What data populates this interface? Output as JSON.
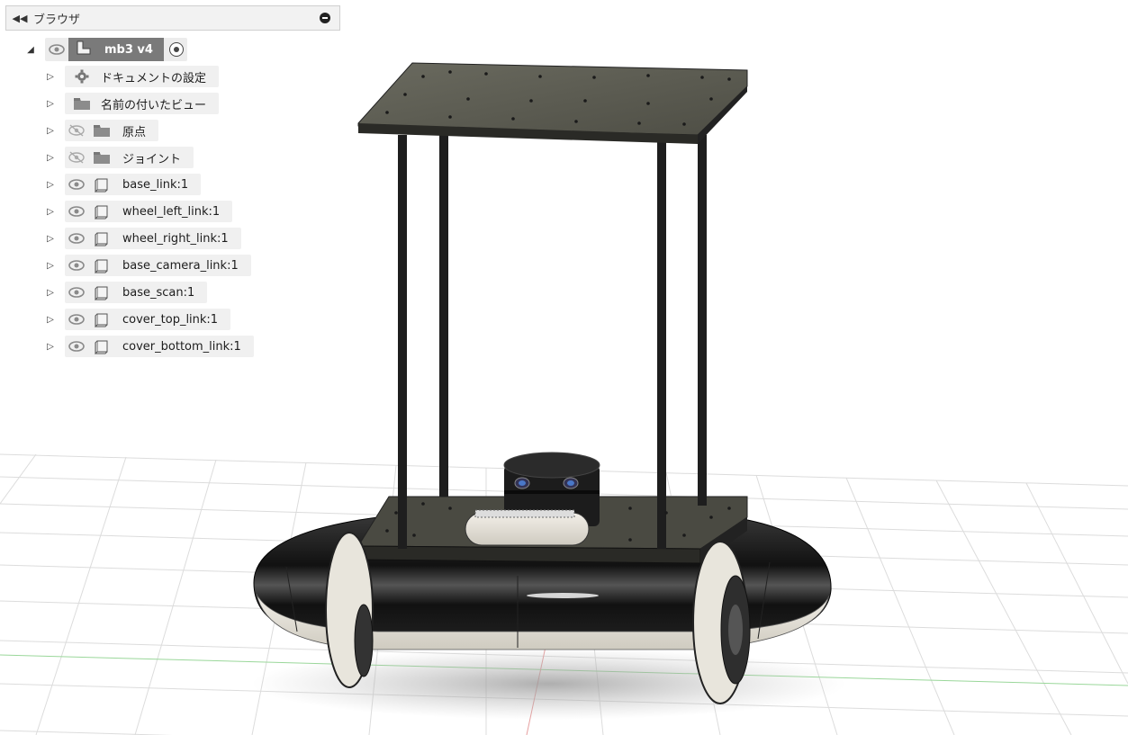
{
  "browser": {
    "title": "ブラウザ",
    "root": {
      "label": "mb3 v4"
    },
    "items": [
      {
        "label": "ドキュメントの設定",
        "icon": "gear-icon",
        "eye": "none",
        "slug": "document-settings"
      },
      {
        "label": "名前の付いたビュー",
        "icon": "folder-icon",
        "eye": "none",
        "slug": "named-views"
      },
      {
        "label": "原点",
        "icon": "folder-icon",
        "eye": "hidden",
        "slug": "origin"
      },
      {
        "label": "ジョイント",
        "icon": "folder-icon",
        "eye": "hidden",
        "slug": "joints"
      },
      {
        "label": "base_link:1",
        "icon": "component-icon",
        "eye": "visible",
        "slug": "base-link"
      },
      {
        "label": "wheel_left_link:1",
        "icon": "component-icon",
        "eye": "visible",
        "slug": "wheel-left-link"
      },
      {
        "label": "wheel_right_link:1",
        "icon": "component-icon",
        "eye": "visible",
        "slug": "wheel-right-link"
      },
      {
        "label": "base_camera_link:1",
        "icon": "component-icon",
        "eye": "visible",
        "slug": "base-camera-link"
      },
      {
        "label": "base_scan:1",
        "icon": "component-icon",
        "eye": "visible",
        "slug": "base-scan"
      },
      {
        "label": "cover_top_link:1",
        "icon": "component-icon",
        "eye": "visible",
        "slug": "cover-top-link"
      },
      {
        "label": "cover_bottom_link:1",
        "icon": "component-icon",
        "eye": "visible",
        "slug": "cover-bottom-link"
      }
    ]
  },
  "colors": {
    "grid": "#d8d8d8",
    "plate": "#5a5a50",
    "chassis": "#1a1a1a",
    "cover": "#e6e3da"
  }
}
